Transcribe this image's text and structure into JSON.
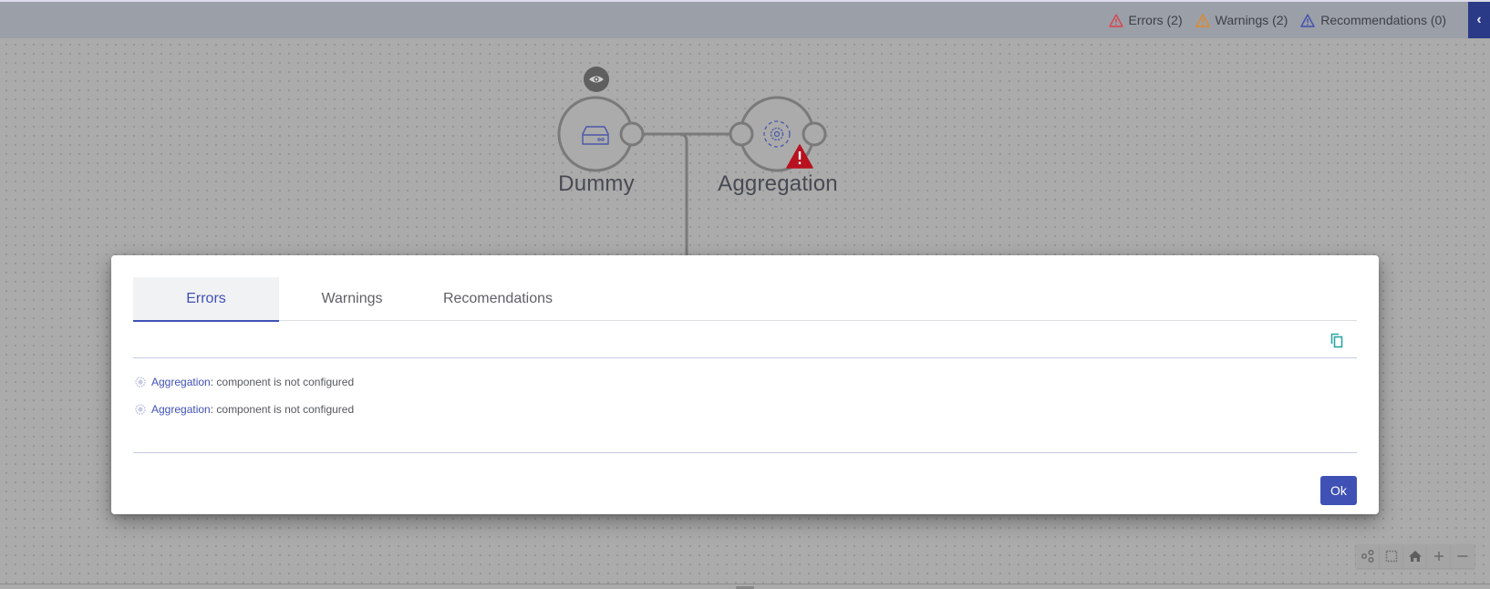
{
  "header": {
    "issues": [
      {
        "label": "Errors (2)",
        "icon": "error-triangle-icon",
        "color": "#d9444f"
      },
      {
        "label": "Warnings (2)",
        "icon": "warning-triangle-icon",
        "color": "#e08a2a"
      },
      {
        "label": "Recommendations (0)",
        "icon": "recommendation-triangle-icon",
        "color": "#3f4fb0"
      }
    ],
    "collapse_icon": "‹",
    "bar_color": "#9b9fa7",
    "collapse_color": "#2b3a86"
  },
  "flow": {
    "nodes": [
      {
        "label": "Dummy",
        "icon": "storage-drive-icon",
        "preview_icon": "eye-icon"
      },
      {
        "label": "Aggregation",
        "icon": "gear-dashed-icon",
        "status": "error",
        "status_color": "#b8111f"
      }
    ]
  },
  "zoom_toolbar": [
    {
      "name": "layout-graph-button",
      "icon": "graph-layout-icon"
    },
    {
      "name": "select-area-button",
      "icon": "dashed-square-icon"
    },
    {
      "name": "home-button",
      "icon": "home-icon"
    },
    {
      "name": "zoom-in-button",
      "icon": "plus-icon"
    },
    {
      "name": "zoom-out-button",
      "icon": "minus-icon"
    }
  ],
  "dialog": {
    "tabs": [
      {
        "label": "Errors",
        "active": true
      },
      {
        "label": "Warnings",
        "active": false
      },
      {
        "label": "Recomendations",
        "active": false
      }
    ],
    "copy_icon": "copy-icon",
    "messages": [
      {
        "component": "Aggregation",
        "separator": ": ",
        "text": "component is not configured"
      },
      {
        "component": "Aggregation",
        "separator": ": ",
        "text": "component is not configured"
      }
    ],
    "ok_label": "Ok",
    "accent": "#3f51b5"
  }
}
